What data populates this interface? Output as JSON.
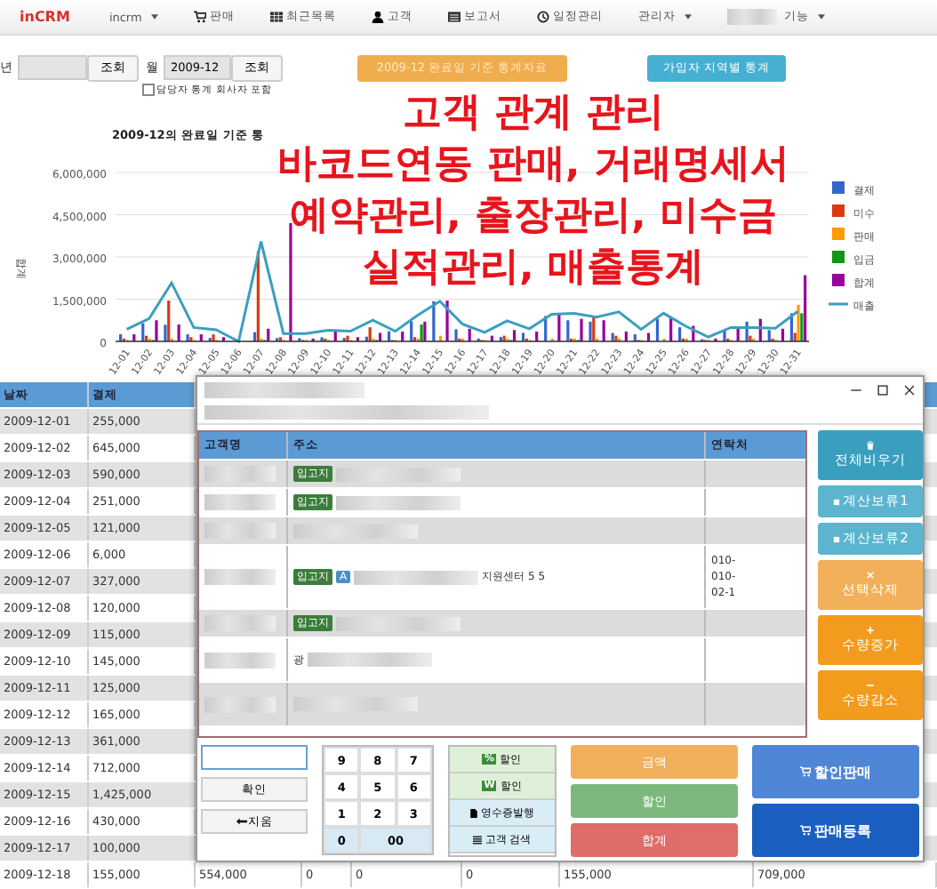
{
  "nav": {
    "logo": "inCRM",
    "items": [
      {
        "kind": "dropdown",
        "label": "incrm"
      },
      {
        "kind": "cart",
        "label": "판매"
      },
      {
        "kind": "grid",
        "label": "최근목록"
      },
      {
        "kind": "person",
        "label": "고객"
      },
      {
        "kind": "report",
        "label": "보고서"
      },
      {
        "kind": "clock",
        "label": "일정관리"
      },
      {
        "kind": "dropdown",
        "label": "관리자"
      },
      {
        "kind": "redacted"
      },
      {
        "kind": "dropdown",
        "label": "기능"
      }
    ]
  },
  "filters": {
    "year_label": "년",
    "year_button": "조회",
    "month_label": "월",
    "month_value": "2009-12",
    "month_button": "조회",
    "include_checkbox": {
      "label": "담당자 통계 회사자 포함",
      "checked": false
    },
    "report_buttons": [
      {
        "kind": "warning",
        "label": "2009-12 완료일 기준 통계자료"
      },
      {
        "kind": "info",
        "label": "가입자 지역별 통계"
      }
    ]
  },
  "chart": {
    "chart_data": {
      "type": "bar",
      "title": "2009-12의 완료일 기준 통",
      "ylabel": "합계",
      "stacked": false,
      "grid": true,
      "legend": true,
      "categories": [
        "12-01",
        "12-02",
        "12-03",
        "12-04",
        "12-05",
        "12-06",
        "12-07",
        "12-08",
        "12-09",
        "12-10",
        "12-11",
        "12-12",
        "12-13",
        "12-14",
        "12-15",
        "12-16",
        "12-17",
        "12-18",
        "12-19",
        "12-20",
        "12-21",
        "12-22",
        "12-23",
        "12-24",
        "12-25",
        "12-26",
        "12-27",
        "12-28",
        "12-29",
        "12-30",
        "12-31"
      ],
      "ylim": [
        0,
        6000000
      ],
      "yticks": [
        {
          "value": 0,
          "label": "0"
        },
        {
          "value": 1500000,
          "label": "1,500,000"
        },
        {
          "value": 3000000,
          "label": "3,000,000"
        },
        {
          "value": 4500000,
          "label": "4,500,000"
        },
        {
          "value": 6000000,
          "label": "6,000,000"
        }
      ],
      "series": [
        {
          "name": "결제",
          "color": "#3366cc",
          "values": [
            255000,
            645000,
            590000,
            251000,
            121000,
            null,
            327000,
            120000,
            115000,
            145000,
            125000,
            165000,
            361000,
            712000,
            1425000,
            430000,
            100000,
            155000,
            300000,
            900000,
            750000,
            700000,
            300000,
            250000,
            800000,
            500000,
            80000,
            400000,
            700000,
            400000,
            1000000
          ]
        },
        {
          "name": "미수",
          "color": "#dc3912",
          "values": [
            100000,
            200000,
            1450000,
            150000,
            250000,
            0,
            3200000,
            150000,
            50000,
            100000,
            200000,
            500000,
            50000,
            150000,
            0,
            100000,
            50000,
            200000,
            100000,
            0,
            100000,
            850000,
            200000,
            50000,
            0,
            100000,
            50000,
            100000,
            200000,
            100000,
            300000
          ]
        },
        {
          "name": "판매",
          "color": "#ff9900",
          "values": [
            50000,
            100000,
            100000,
            50000,
            50000,
            0,
            100000,
            50000,
            50000,
            50000,
            50000,
            100000,
            50000,
            100000,
            200000,
            100000,
            50000,
            100000,
            50000,
            100000,
            100000,
            100000,
            100000,
            50000,
            100000,
            100000,
            50000,
            50000,
            100000,
            50000,
            1300000
          ]
        },
        {
          "name": "입금",
          "color": "#109618",
          "values": [
            0,
            50000,
            0,
            0,
            0,
            0,
            50000,
            0,
            0,
            0,
            0,
            50000,
            0,
            600000,
            0,
            0,
            0,
            50000,
            0,
            0,
            50000,
            0,
            0,
            0,
            0,
            0,
            0,
            0,
            0,
            0,
            1000000
          ]
        },
        {
          "name": "합계",
          "color": "#990099",
          "values": [
            250000,
            750000,
            600000,
            250000,
            150000,
            0,
            450000,
            4200000,
            100000,
            400000,
            150000,
            300000,
            350000,
            700000,
            1450000,
            450000,
            200000,
            400000,
            350000,
            950000,
            800000,
            750000,
            350000,
            300000,
            850000,
            550000,
            100000,
            450000,
            800000,
            450000,
            2350000
          ]
        },
        {
          "name": "매출",
          "color": "#3a9fbf",
          "type": "line",
          "values": [
            430000,
            810000,
            2080000,
            490000,
            410000,
            0,
            3550000,
            280000,
            280000,
            400000,
            360000,
            750000,
            360000,
            920000,
            1430000,
            620000,
            320000,
            730000,
            450000,
            960000,
            1000000,
            860000,
            1050000,
            430000,
            1000000,
            540000,
            150000,
            490000,
            490000,
            470000,
            1070000
          ]
        }
      ]
    }
  },
  "overlay_lines": [
    "고객 관계 관리",
    "바코드연동 판매, 거래명세서",
    "예약관리, 출장관리, 미수금",
    "실적관리, 매출통계"
  ],
  "table": {
    "columns": [
      "날짜",
      "결제"
    ],
    "rows": [
      {
        "cells": [
          "2009-12-01",
          "255,000"
        ]
      },
      {
        "cells": [
          "2009-12-02",
          "645,000"
        ]
      },
      {
        "cells": [
          "2009-12-03",
          "590,000"
        ]
      },
      {
        "cells": [
          "2009-12-04",
          "251,000"
        ]
      },
      {
        "cells": [
          "2009-12-05",
          "121,000"
        ]
      },
      {
        "cells": [
          "2009-12-06",
          "6,000"
        ]
      },
      {
        "cells": [
          "2009-12-07",
          "327,000"
        ]
      },
      {
        "cells": [
          "2009-12-08",
          "120,000"
        ]
      },
      {
        "cells": [
          "2009-12-09",
          "115,000"
        ]
      },
      {
        "cells": [
          "2009-12-10",
          "145,000"
        ]
      },
      {
        "cells": [
          "2009-12-11",
          "125,000"
        ]
      },
      {
        "cells": [
          "2009-12-12",
          "165,000"
        ]
      },
      {
        "cells": [
          "2009-12-13",
          "361,000"
        ]
      },
      {
        "cells": [
          "2009-12-14",
          "712,000"
        ]
      },
      {
        "cells": [
          "2009-12-15",
          "1,425,000"
        ]
      },
      {
        "cells": [
          "2009-12-16",
          "430,000"
        ]
      },
      {
        "cells": [
          "2009-12-17",
          "100,000"
        ]
      },
      {
        "cells": [
          "2009-12-18",
          "155,000",
          "554,000",
          "0",
          "0",
          "0",
          "155,000",
          "709,000"
        ]
      }
    ]
  },
  "dialog": {
    "customer_table": {
      "columns": [
        "고객명",
        "주소",
        "연락처"
      ],
      "rows": [
        {
          "address": [
            {
              "kind": "badge",
              "text": "입고지"
            },
            {
              "kind": "redacted"
            }
          ]
        },
        {
          "address": [
            {
              "kind": "badge",
              "text": "입고지"
            },
            {
              "kind": "redacted"
            }
          ]
        },
        {
          "address": [
            {
              "kind": "redacted"
            }
          ]
        },
        {
          "address": [
            {
              "kind": "badge",
              "text": "입고지"
            },
            {
              "kind": "tag",
              "text": "A"
            },
            {
              "kind": "redacted"
            },
            {
              "kind": "text",
              "text": "지원센터 5 5"
            }
          ],
          "contact": [
            "010-",
            "010-",
            "02-1"
          ]
        },
        {
          "address": [
            {
              "kind": "badge",
              "text": "입고지"
            },
            {
              "kind": "redacted"
            }
          ]
        },
        {
          "address": [
            {
              "kind": "text",
              "text": "광"
            },
            {
              "kind": "redacted"
            }
          ]
        },
        {
          "address": [
            {
              "kind": "redacted"
            }
          ]
        }
      ]
    },
    "side_buttons": [
      {
        "kind": "clear",
        "label": "전체비우기"
      },
      {
        "kind": "hold",
        "label": "계산보류1"
      },
      {
        "kind": "hold",
        "label": "계산보류2"
      },
      {
        "kind": "delete",
        "label": "선택삭제"
      },
      {
        "kind": "increase",
        "label": "수량증가"
      },
      {
        "kind": "decrease",
        "label": "수량감소"
      }
    ],
    "confirm_button": "확인",
    "erase_button": "지움",
    "keypad": [
      {
        "kind": "digit",
        "label": "9"
      },
      {
        "kind": "digit",
        "label": "8"
      },
      {
        "kind": "digit",
        "label": "7"
      },
      {
        "kind": "digit",
        "label": "4"
      },
      {
        "kind": "digit",
        "label": "5"
      },
      {
        "kind": "digit",
        "label": "6"
      },
      {
        "kind": "digit",
        "label": "1"
      },
      {
        "kind": "digit",
        "label": "2"
      },
      {
        "kind": "digit",
        "label": "3"
      },
      {
        "kind": "zero",
        "label": "0"
      },
      {
        "kind": "double-zero",
        "label": "00"
      }
    ],
    "discount_buttons": [
      {
        "kind": "percent",
        "badge": "%",
        "label": "할인"
      },
      {
        "kind": "won",
        "badge": "W",
        "label": "할인"
      },
      {
        "kind": "receipt",
        "label": "영수증발행"
      },
      {
        "kind": "search",
        "label": "고객 검색"
      }
    ],
    "totals": [
      {
        "kind": "amount",
        "label": "금액"
      },
      {
        "kind": "discount",
        "label": "할인"
      },
      {
        "kind": "total",
        "label": "합계"
      }
    ],
    "actions": [
      {
        "kind": "discount-sale",
        "label": "할인판매"
      },
      {
        "kind": "register",
        "label": "판매등록"
      }
    ]
  }
}
